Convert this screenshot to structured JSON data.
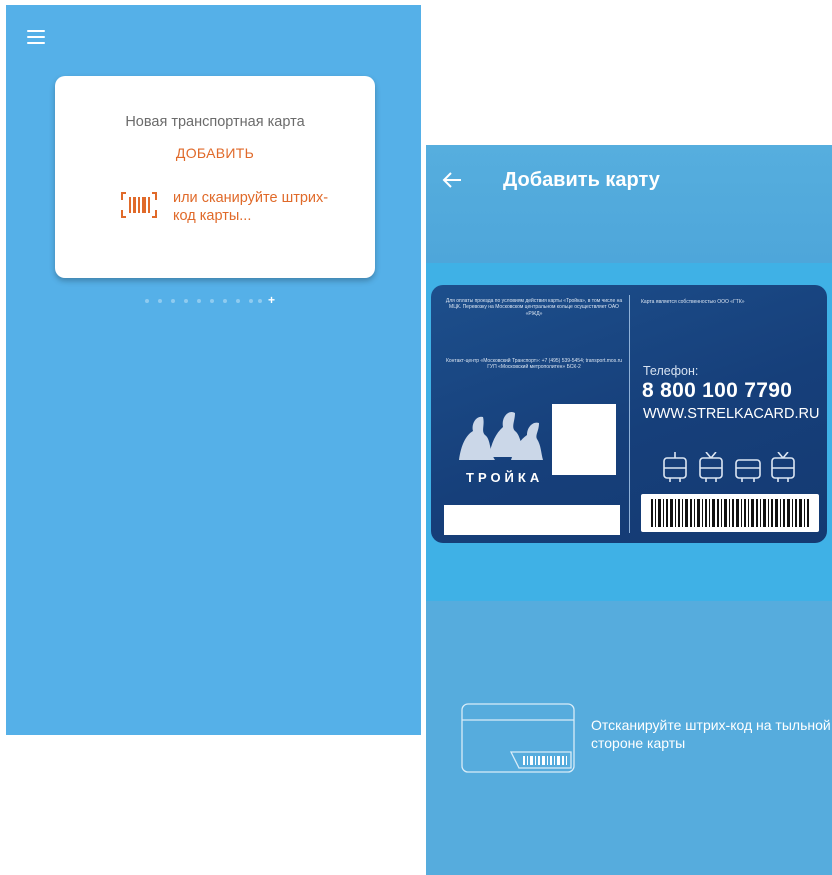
{
  "left_screen": {
    "card": {
      "title": "Новая транспортная карта",
      "add_label": "ДОБАВИТЬ",
      "scan_label": "или сканируйте штрих-код карты..."
    },
    "pager": {
      "count": 10,
      "active_symbol": "+"
    },
    "colors": {
      "background": "#55b0e8",
      "accent": "#e06a2a"
    }
  },
  "right_screen": {
    "header": {
      "title": "Добавить карту"
    },
    "card": {
      "left_text": "Для оплаты проезда по условиям действия карты «Тройка», в том числе на МЦК. Перевозку на Московском центральном кольце осуществляет ОАО «РЖД»",
      "contact_text": "Контакт-центр «Московский Транспорт»: +7 (495) 539-5454; transport.mos.ru ГУП «Московский метрополитен» БСК-2",
      "ownership_text": "Карта является собственностью ООО «ГТК»",
      "phone_label": "Телефон:",
      "phone": "8 800 100 7790",
      "website": "WWW.STRELKACARD.RU",
      "brand": "ТРОЙКА"
    },
    "hint": "Отсканируйте штрих-код на тыльной стороне карты",
    "colors": {
      "background": "#4fa8dc",
      "card": "#1a4884"
    }
  }
}
